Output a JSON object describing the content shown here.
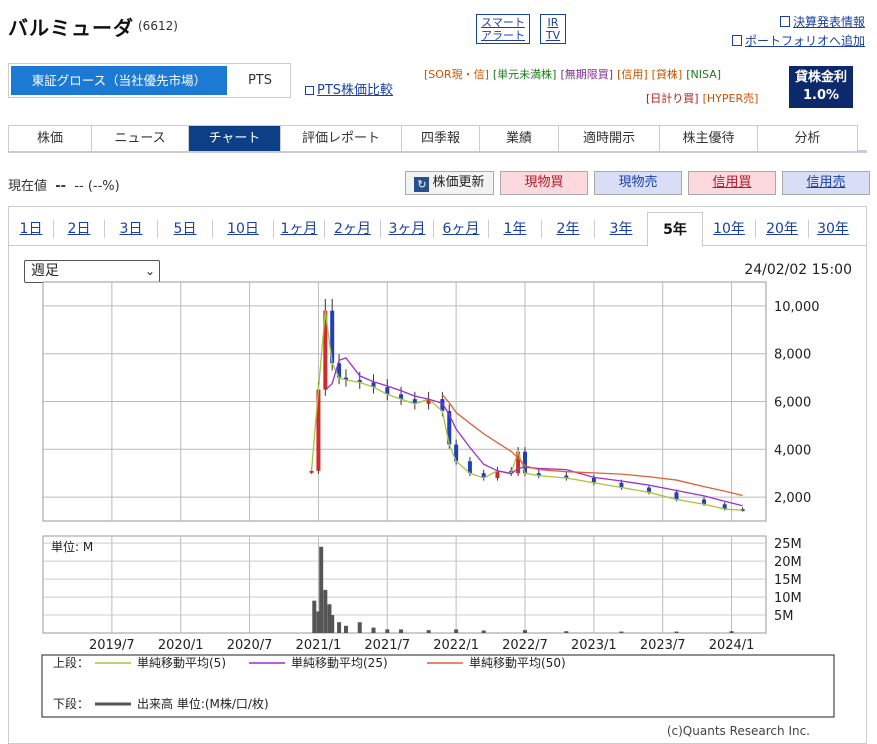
{
  "header": {
    "title": "バルミューダ",
    "code": "(6612)",
    "alert": "スマート\nアラート",
    "irtv": "IR\nTV",
    "link_results": "決算発表情報",
    "link_portfolio": "ポートフォリオへ追加"
  },
  "market": {
    "primary": "東証グロース（当社優先市場）",
    "pts": "PTS",
    "pts_compare": "PTS株価比較"
  },
  "tags_row1": [
    {
      "t": "[SOR現・信]",
      "c": "#c65300"
    },
    {
      "t": "[単元未満株]",
      "c": "#1a7a1a"
    },
    {
      "t": "[無期限買]",
      "c": "#7b2b8f"
    },
    {
      "t": "[信用]",
      "c": "#c65300"
    },
    {
      "t": "[貸株]",
      "c": "#c65300"
    },
    {
      "t": "[NISA]",
      "c": "#1a7a1a"
    }
  ],
  "tags_row2": [
    {
      "t": "[日計り買]",
      "c": "#b31a1a"
    },
    {
      "t": "[HYPER売]",
      "c": "#c65300"
    }
  ],
  "loan": {
    "label": "貸株金利",
    "rate": "1.0%"
  },
  "nav": [
    "株価",
    "ニュース",
    "チャート",
    "評価レポート",
    "四季報",
    "業績",
    "適時開示",
    "株主優待",
    "分析"
  ],
  "nav_active": 2,
  "price": {
    "label": "現在値",
    "value": "--",
    "change": "-- (--%)"
  },
  "buttons": {
    "refresh": "株価更新",
    "spot_buy": "現物買",
    "spot_sell": "現物売",
    "margin_buy": "信用買",
    "margin_sell": "信用売"
  },
  "periods": [
    "1日",
    "2日",
    "3日",
    "5日",
    "10日",
    "1ヶ月",
    "2ヶ月",
    "3ヶ月",
    "6ヶ月",
    "1年",
    "2年",
    "3年",
    "5年",
    "10年",
    "20年",
    "30年"
  ],
  "period_active": 12,
  "interval": "週足",
  "datetime": "24/02/02 15:00",
  "chart_data": {
    "type": "line",
    "price_axis": {
      "ylim": [
        1000,
        11000
      ],
      "ticks": [
        "2,000",
        "4,000",
        "6,000",
        "8,000",
        "10,000"
      ]
    },
    "x_ticks": [
      "2019/7",
      "2020/1",
      "2020/7",
      "2021/1",
      "2021/7",
      "2022/1",
      "2022/7",
      "2023/1",
      "2023/7",
      "2024/1"
    ],
    "weekly_close": [
      [
        2020.95,
        3100
      ],
      [
        2021.0,
        6500
      ],
      [
        2021.05,
        9800
      ],
      [
        2021.1,
        7600
      ],
      [
        2021.15,
        7000
      ],
      [
        2021.2,
        6900
      ],
      [
        2021.3,
        6800
      ],
      [
        2021.4,
        6600
      ],
      [
        2021.5,
        6300
      ],
      [
        2021.6,
        6100
      ],
      [
        2021.7,
        5900
      ],
      [
        2021.8,
        6100
      ],
      [
        2021.9,
        5600
      ],
      [
        2021.95,
        4200
      ],
      [
        2022.0,
        3500
      ],
      [
        2022.1,
        3000
      ],
      [
        2022.2,
        2800
      ],
      [
        2022.3,
        3100
      ],
      [
        2022.4,
        3000
      ],
      [
        2022.45,
        3900
      ],
      [
        2022.5,
        3000
      ],
      [
        2022.6,
        2900
      ],
      [
        2022.8,
        2800
      ],
      [
        2023.0,
        2600
      ],
      [
        2023.2,
        2400
      ],
      [
        2023.4,
        2200
      ],
      [
        2023.6,
        1900
      ],
      [
        2023.8,
        1700
      ],
      [
        2023.95,
        1500
      ],
      [
        2024.08,
        1450
      ]
    ],
    "series": [
      {
        "name": "単純移動平均(5)",
        "color": "#a8c43a"
      },
      {
        "name": "単純移動平均(25)",
        "color": "#9b2fd0"
      },
      {
        "name": "単純移動平均(50)",
        "color": "#e0603a"
      }
    ],
    "volume_axis": {
      "ticks": [
        "5M",
        "10M",
        "15M",
        "20M",
        "25M"
      ],
      "unit_label": "単位: M"
    },
    "volume": [
      [
        2020.97,
        9
      ],
      [
        2021.0,
        6
      ],
      [
        2021.02,
        24
      ],
      [
        2021.05,
        12
      ],
      [
        2021.08,
        8
      ],
      [
        2021.1,
        5
      ],
      [
        2021.15,
        3
      ],
      [
        2021.2,
        2
      ],
      [
        2021.3,
        3
      ],
      [
        2021.4,
        1.5
      ],
      [
        2021.5,
        1
      ],
      [
        2021.6,
        1
      ],
      [
        2021.8,
        0.8
      ],
      [
        2022.0,
        1
      ],
      [
        2022.2,
        0.7
      ],
      [
        2022.5,
        0.8
      ],
      [
        2022.8,
        0.5
      ],
      [
        2023.2,
        0.4
      ],
      [
        2023.6,
        0.4
      ],
      [
        2024.0,
        0.5
      ]
    ]
  },
  "legend": {
    "upper_label": "上段：",
    "ma5": "単純移動平均(5)",
    "ma25": "単純移動平均(25)",
    "ma50": "単純移動平均(50)",
    "lower_label": "下段：",
    "volume": "出来高 単位:(M株/口/枚)"
  },
  "copyright": "(c)Quants Research Inc."
}
